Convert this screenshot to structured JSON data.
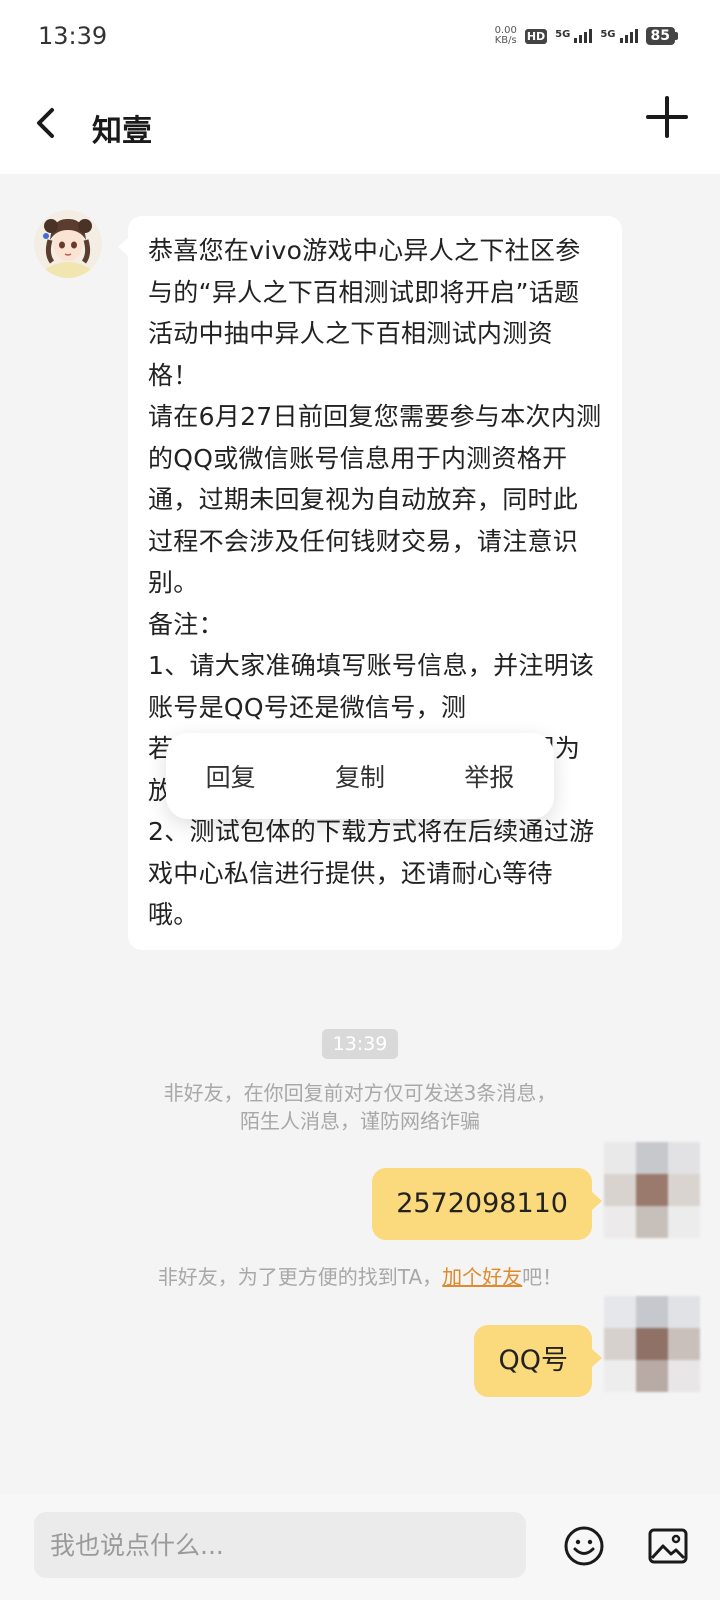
{
  "status_bar": {
    "time": "13:39",
    "net_speed_value": "0.00",
    "net_speed_unit": "KB/s",
    "hd_label": "HD",
    "sim1_label": "5G",
    "sim2_label": "5G",
    "battery": "85"
  },
  "header": {
    "title": "知壹",
    "back_icon": "chevron-left",
    "more_icon": "plus"
  },
  "messages": {
    "incoming_text": "恭喜您在vivo游戏中心异人之下社区参与的“异人之下百相测试即将开启”话题活动中抽中异人之下百相测试内测资格！\n请在6月27日前回复您需要参与本次内测的QQ或微信账号信息用于内测资格开通，过期未回复视为自动放弃，同时此过程不会涉及任何钱财交易，请注意识别。\n备注：\n1、请大家准确填写账号信息，并注明该账号是QQ号还是微信号，测\n若                                  通失败视为放弃资格；\n2、测试包体的下载方式将在后续通过游戏中心私信进行提供，还请耐心等待哦。",
    "timestamp": "13:39",
    "notice_1_line1": "非好友，在你回复前对方仅可发送3条消息，",
    "notice_1_line2": "陌生人消息，谨防网络诈骗",
    "outgoing_1": "2572098110",
    "notice_2_prefix": "非好友，为了更方便的找到TA，",
    "notice_2_link": "加个好友",
    "notice_2_suffix": "吧！",
    "outgoing_2": "QQ号"
  },
  "context_menu": {
    "reply": "回复",
    "copy": "复制",
    "report": "举报"
  },
  "input": {
    "placeholder": "我也说点什么..."
  },
  "colors": {
    "outgoing_bubble": "#fbd97d",
    "link": "#e08a2e",
    "background": "#f4f4f4"
  }
}
